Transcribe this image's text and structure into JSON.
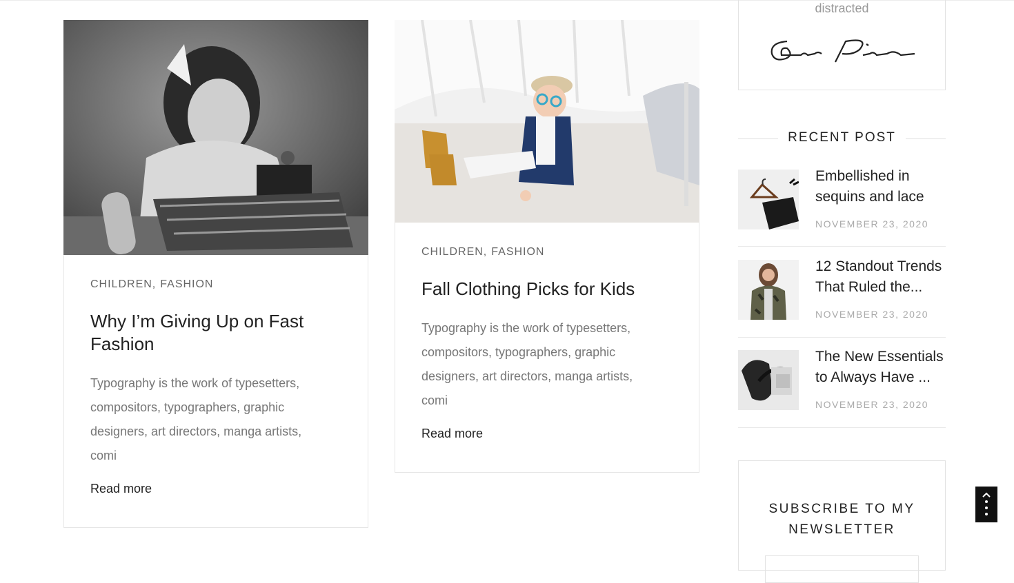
{
  "posts": [
    {
      "categories": [
        "CHILDREN",
        "FASHION"
      ],
      "title": "Why I’m Giving Up on Fast Fashion",
      "excerpt": "Typography is the work of typesetters, compositors, typographers, graphic designers, art directors, manga artists, comi",
      "read_more": "Read more"
    },
    {
      "categories": [
        "CHILDREN",
        "FASHION"
      ],
      "title": "Fall Clothing Picks for Kids",
      "excerpt": "Typography is the work of typesetters, compositors, typographers, graphic designers, art directors, manga artists, comi",
      "read_more": "Read more"
    }
  ],
  "sidebar": {
    "about": {
      "tail_text": "distracted",
      "signature": "Solo Pine"
    },
    "recent_post": {
      "title": "RECENT POST",
      "items": [
        {
          "title": "Embellished in sequins and lace",
          "date": "NOVEMBER 23, 2020"
        },
        {
          "title": "12 Standout Trends That Ruled the...",
          "date": "NOVEMBER 23, 2020"
        },
        {
          "title": "The New Essentials to Always Have ...",
          "date": "NOVEMBER 23, 2020"
        }
      ]
    },
    "newsletter": {
      "title_line1": "SUBSCRIBE TO MY",
      "title_line2": "NEWSLETTER"
    }
  },
  "icons": {
    "back_to_top": "chevron-up-icon",
    "menu": "vertical-dots-icon"
  }
}
